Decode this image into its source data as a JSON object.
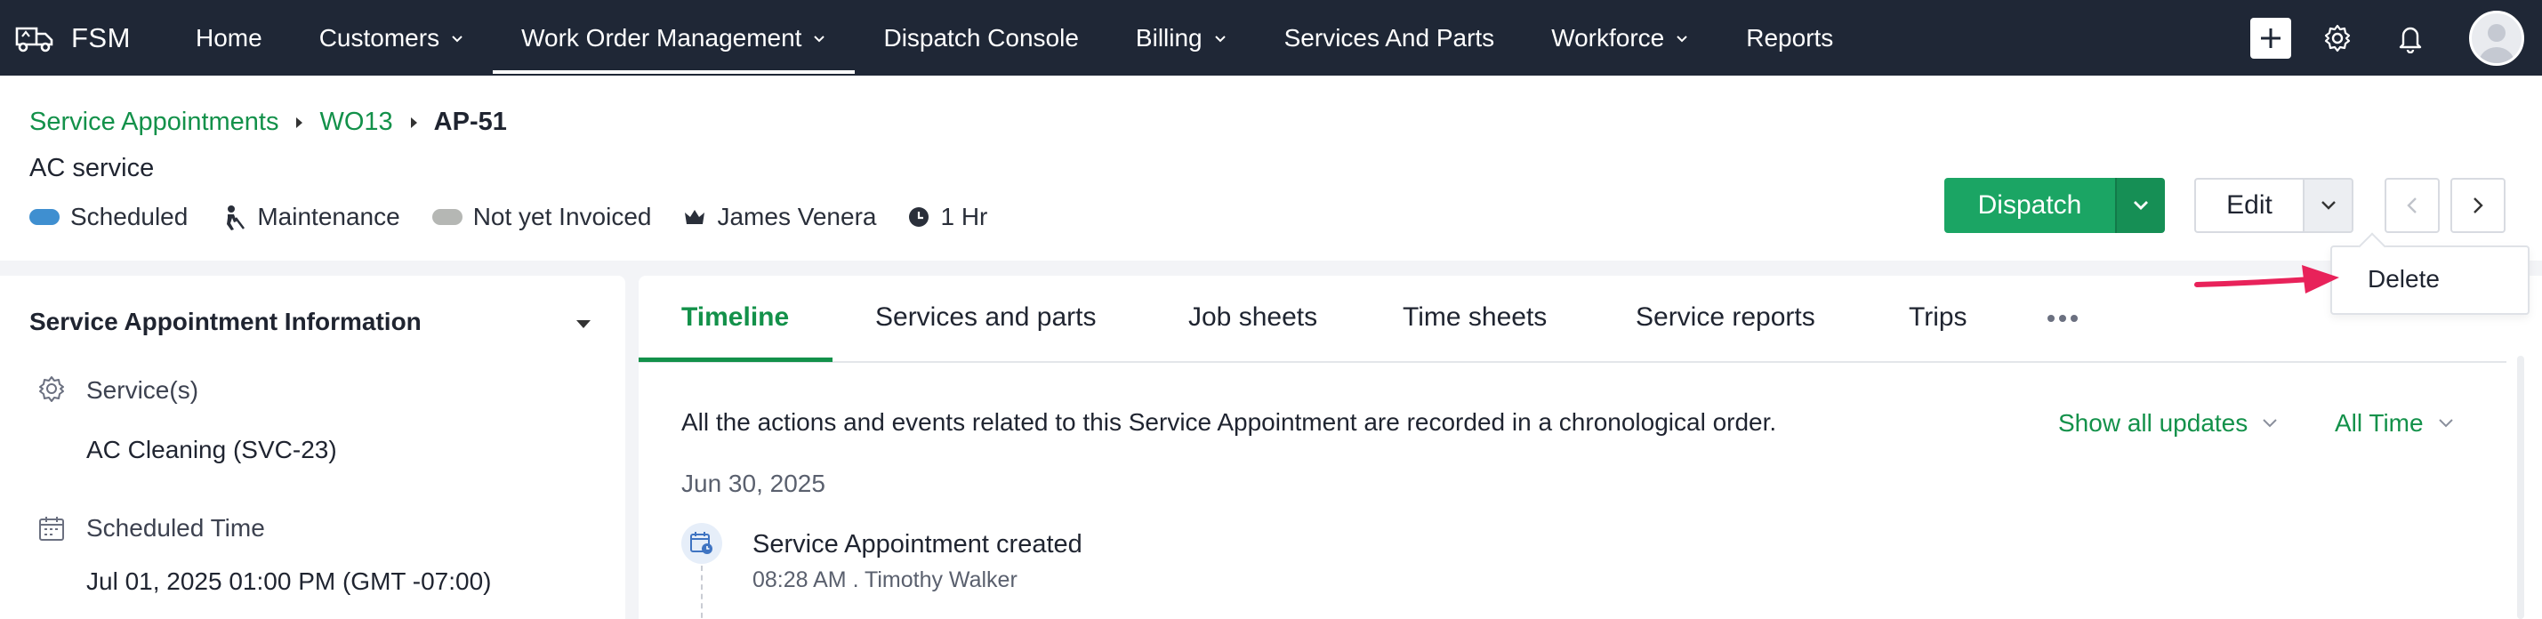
{
  "nav": {
    "logo_text": "FSM",
    "menu": [
      {
        "label": "Home",
        "dropdown": false
      },
      {
        "label": "Customers",
        "dropdown": true
      },
      {
        "label": "Work Order Management",
        "dropdown": true,
        "active": true
      },
      {
        "label": "Dispatch Console",
        "dropdown": false
      },
      {
        "label": "Billing",
        "dropdown": true
      },
      {
        "label": "Services And Parts",
        "dropdown": false
      },
      {
        "label": "Workforce",
        "dropdown": true
      },
      {
        "label": "Reports",
        "dropdown": false
      }
    ]
  },
  "breadcrumb": {
    "items": [
      "Service Appointments",
      "WO13"
    ],
    "current": "AP-51"
  },
  "record": {
    "subtitle": "AC service",
    "meta": [
      {
        "icon": "status-pill",
        "label": "Scheduled",
        "color": "#3f8fd0"
      },
      {
        "icon": "worker-icon",
        "label": "Maintenance"
      },
      {
        "icon": "status-pill",
        "label": "Not yet Invoiced",
        "color": "#b5b7b4"
      },
      {
        "icon": "crown-icon",
        "label": "James Venera"
      },
      {
        "icon": "clock-icon",
        "label": "1 Hr"
      }
    ]
  },
  "actions": {
    "dispatch_label": "Dispatch",
    "edit_label": "Edit",
    "menu_items": [
      "Delete"
    ]
  },
  "left_panel": {
    "title": "Service Appointment Information",
    "fields": [
      {
        "icon": "gear-icon",
        "label": "Service(s)",
        "values": [
          "AC Cleaning (SVC-23)"
        ]
      },
      {
        "icon": "calendar-icon",
        "label": "Scheduled Time",
        "values": [
          "Jul 01, 2025 01:00 PM (GMT -07:00)"
        ]
      }
    ]
  },
  "tabs": [
    "Timeline",
    "Services and parts",
    "Job sheets",
    "Time sheets",
    "Service reports",
    "Trips"
  ],
  "timeline": {
    "description": "All the actions and events related to this Service Appointment are recorded in a chronological order.",
    "filter_updates": "Show all updates",
    "filter_time": "All Time",
    "date": "Jun 30, 2025",
    "event": {
      "title": "Service Appointment created",
      "time": "08:28 AM",
      "user": "Timothy Walker",
      "sub": "08:28 AM . Timothy Walker"
    }
  },
  "colors": {
    "nav_bg": "#1f2736",
    "accent_green": "#13914a",
    "dispatch_green": "#1ba564",
    "annotation_arrow": "#e8225a"
  }
}
